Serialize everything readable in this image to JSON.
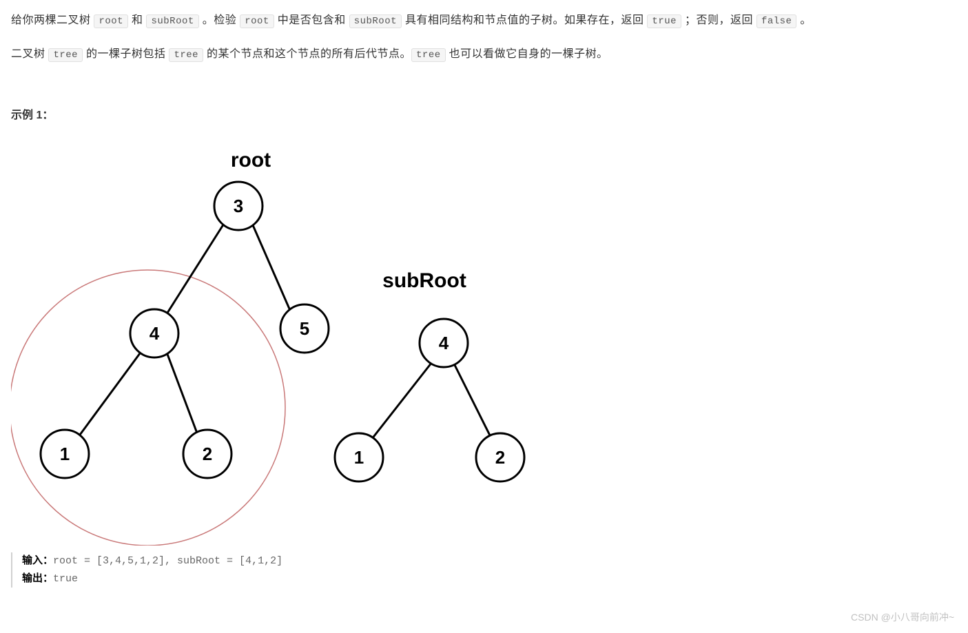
{
  "p1": {
    "a": "给你两棵二叉树 ",
    "c1": "root",
    "b": " 和 ",
    "c2": "subRoot",
    "c": " 。检验 ",
    "c3": "root",
    "d": " 中是否包含和 ",
    "c4": "subRoot",
    "e": " 具有相同结构和节点值的子树。如果存在，返回 ",
    "c5": "true",
    "f": " ；否则，返回 ",
    "c6": "false",
    "g": " 。"
  },
  "p2": {
    "a": "二叉树 ",
    "c1": "tree",
    "b": " 的一棵子树包括 ",
    "c2": "tree",
    "c": " 的某个节点和这个节点的所有后代节点。",
    "c3": "tree",
    "d": " 也可以看做它自身的一棵子树。"
  },
  "exampleTitle": "示例 1：",
  "labels": {
    "root": "root",
    "subRoot": "subRoot"
  },
  "tree": {
    "root": {
      "n0": "3",
      "n1": "4",
      "n2": "5",
      "n3": "1",
      "n4": "2"
    },
    "sub": {
      "n0": "4",
      "n1": "1",
      "n2": "2"
    }
  },
  "example": {
    "inLabel": "输入：",
    "inValue": "root = [3,4,5,1,2], subRoot = [4,1,2]",
    "outLabel": "输出：",
    "outValue": "true"
  },
  "watermark": "CSDN @小八哥向前冲~"
}
